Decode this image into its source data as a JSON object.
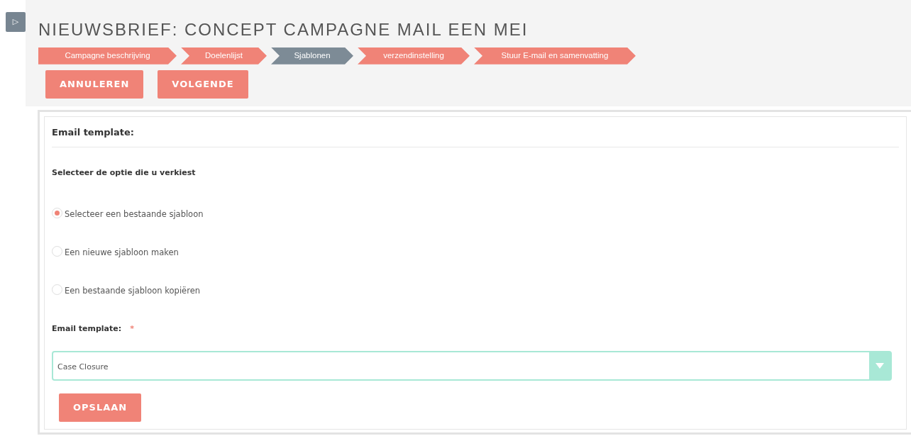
{
  "sidebar_toggle": {
    "label": "▷"
  },
  "title": "NIEUWSBRIEF: CONCEPT CAMPAGNE MAIL EEN MEI",
  "steps": [
    {
      "label": "Campagne beschrijving",
      "selected": false
    },
    {
      "label": "Doelenlijst",
      "selected": false
    },
    {
      "label": "Sjablonen",
      "selected": true
    },
    {
      "label": "verzendinstelling",
      "selected": false
    },
    {
      "label": "Stuur E-mail en samenvatting",
      "selected": false
    }
  ],
  "actions": [
    "ANNULEREN",
    "VOLGENDE"
  ],
  "panel": {
    "heading": "Email template:",
    "prompt": "Selecteer de optie die u verkiest",
    "options": [
      {
        "label": "Selecteer een bestaande sjabloon",
        "selected": true
      },
      {
        "label": "Een nieuwe sjabloon maken",
        "selected": false
      },
      {
        "label": "Een bestaande sjabloon kopiëren",
        "selected": false
      }
    ],
    "field": {
      "label": "Email template:",
      "required_mark": "*",
      "value": "Case Closure"
    },
    "save_button": "OPSLAAN"
  }
}
